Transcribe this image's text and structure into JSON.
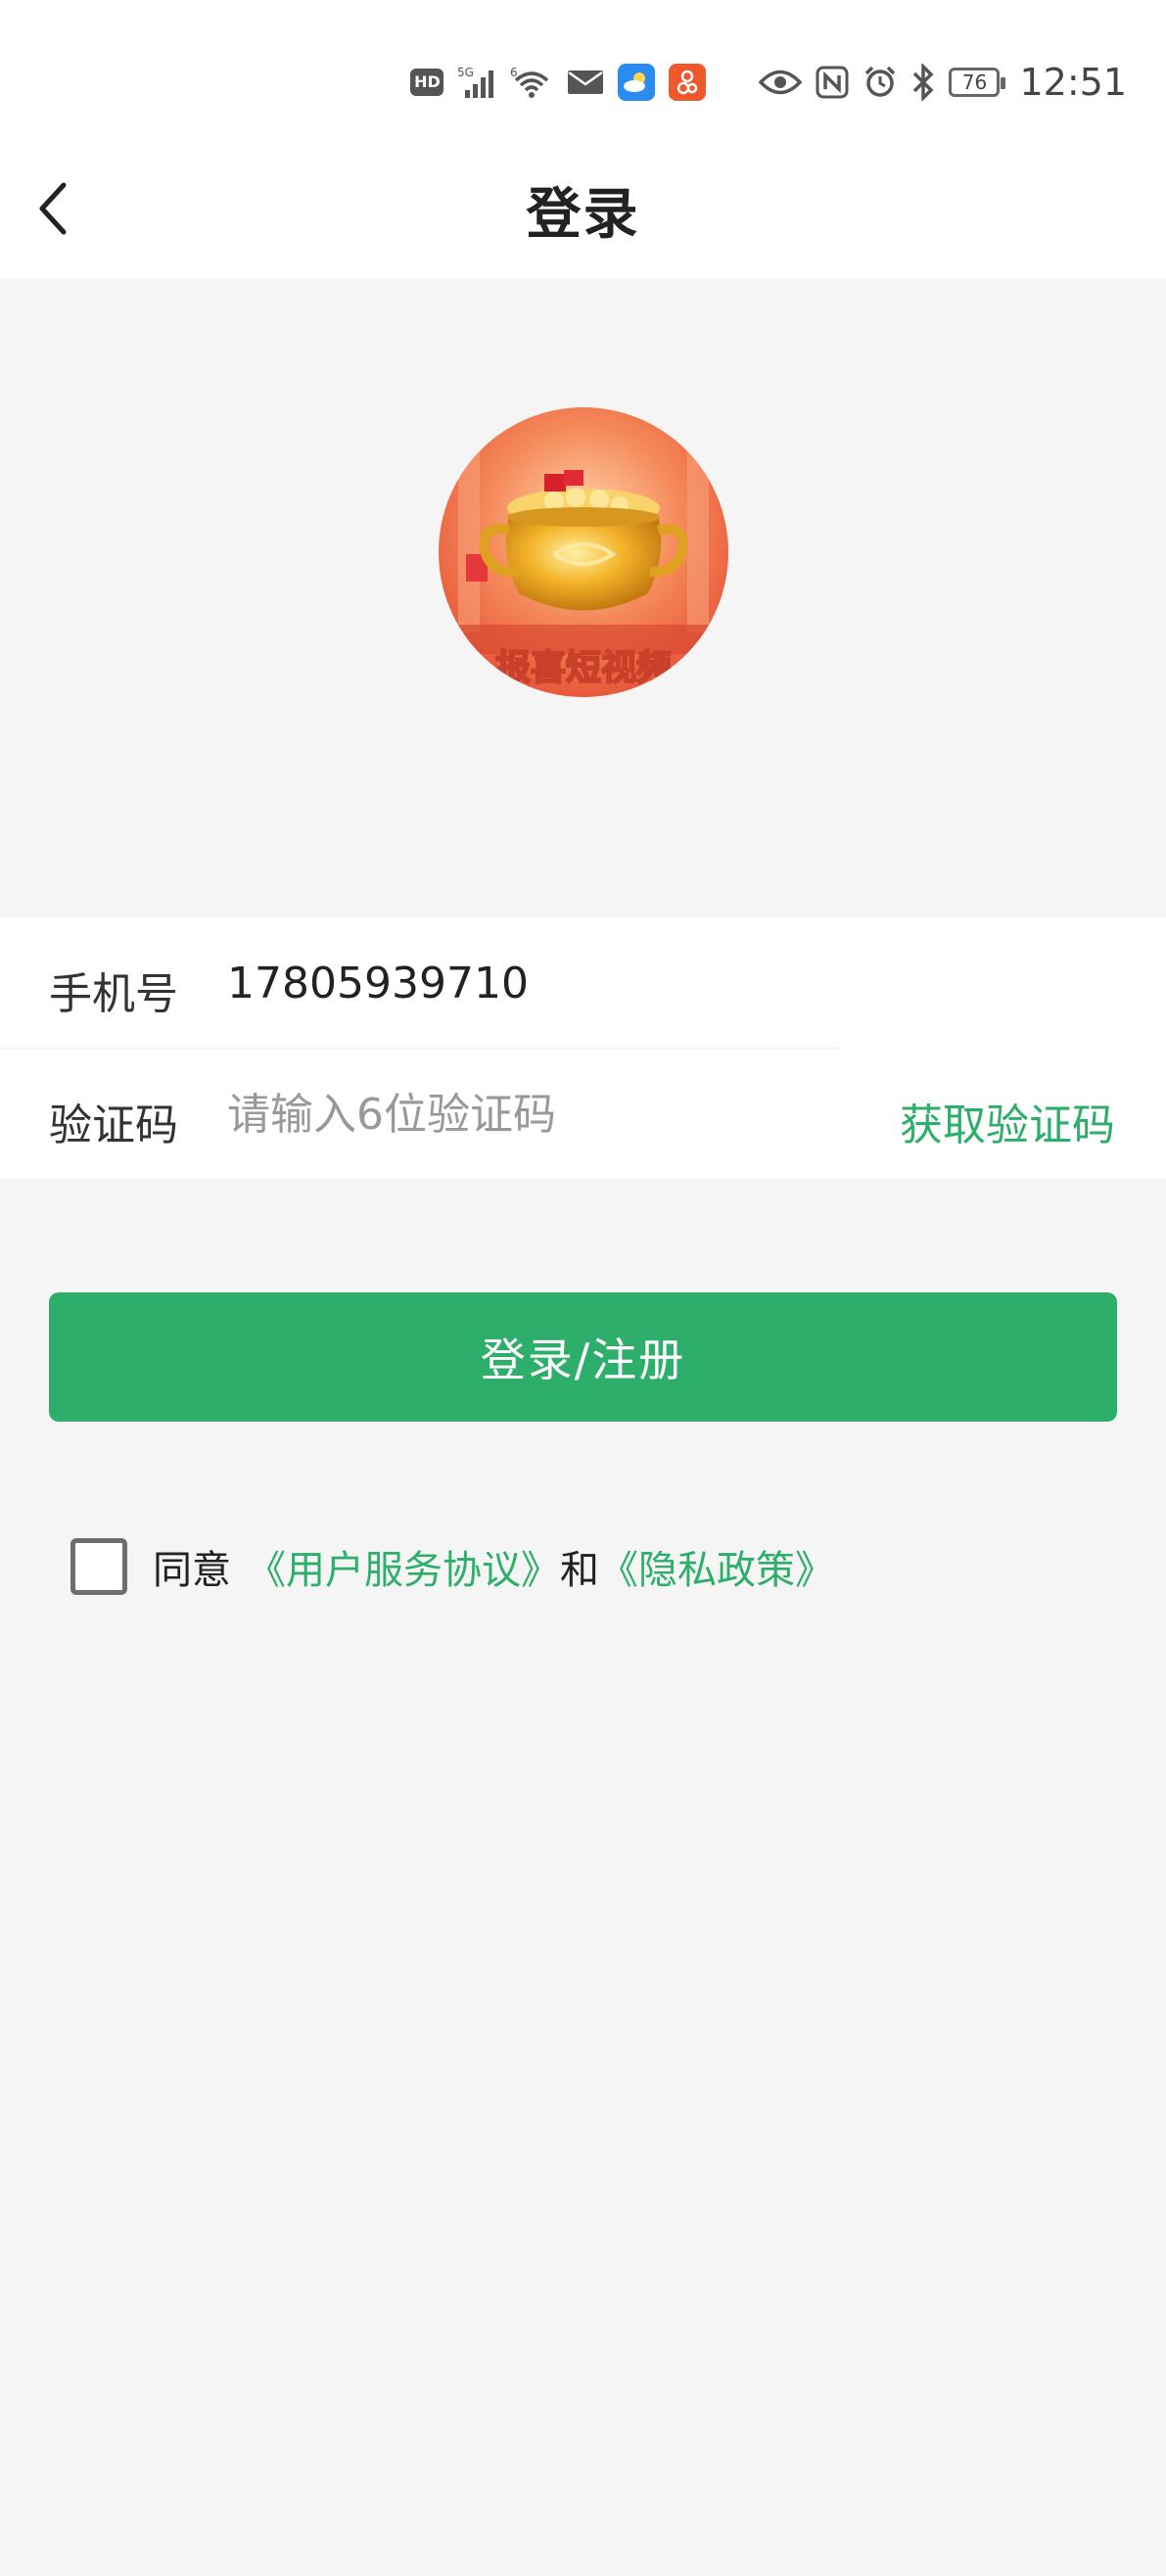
{
  "status_bar": {
    "time": "12:51",
    "battery": "76",
    "hd_badge": "HD",
    "icons": [
      "hd-icon",
      "signal-5g-icon",
      "signal-6-wifi-icon",
      "mail-icon",
      "weather-app-icon",
      "app-notification-icon",
      "eye-icon",
      "nfc-icon",
      "alarm-icon",
      "bluetooth-icon",
      "battery-icon"
    ]
  },
  "header": {
    "title": "登录",
    "back_icon": "chevron-left-icon"
  },
  "logo": {
    "text": "报喜短视频"
  },
  "form": {
    "phone_label": "手机号",
    "phone_value": "17805939710",
    "code_label": "验证码",
    "code_placeholder": "请输入6位验证码",
    "get_code_label": "获取验证码"
  },
  "login_button_label": "登录/注册",
  "agreement": {
    "prefix": "同意",
    "terms_link": "《用户服务协议》",
    "conjunction": "和",
    "privacy_link": "《隐私政策》",
    "checked": false
  },
  "colors": {
    "accent": "#2daf6b",
    "background": "#f5f5f5",
    "surface": "#ffffff"
  }
}
